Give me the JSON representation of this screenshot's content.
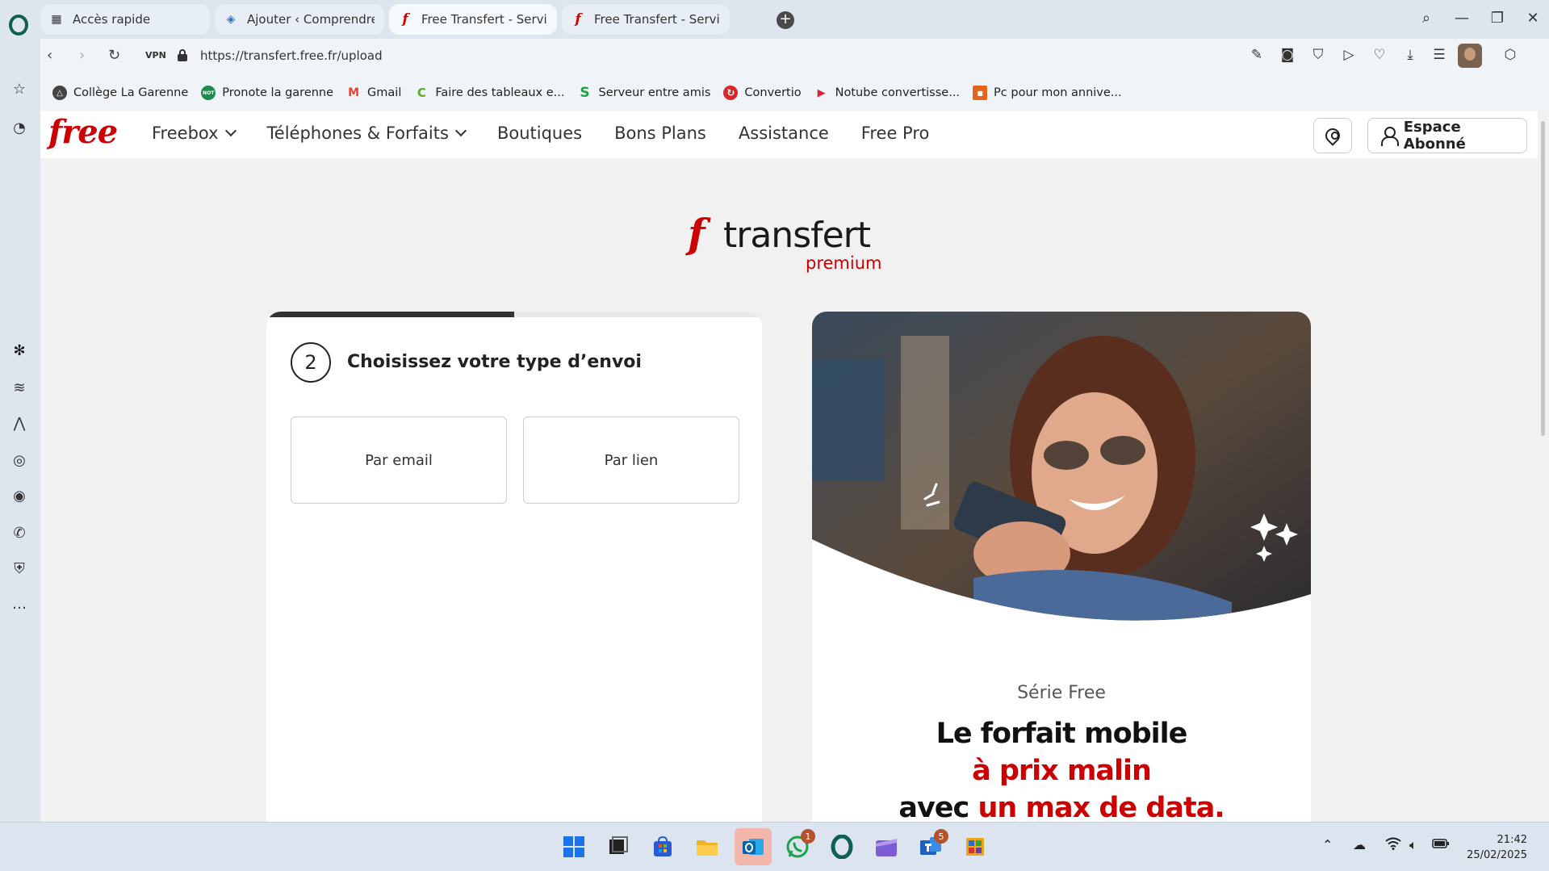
{
  "browser": {
    "tabs": [
      {
        "label": "Accès rapide",
        "icon": "grid-icon",
        "active": false
      },
      {
        "label": "Ajouter ‹ Comprendre l'i",
        "icon": "wordpress-icon",
        "active": false
      },
      {
        "label": "Free Transfert - Service d",
        "icon": "free-favicon",
        "active": true
      },
      {
        "label": "Free Transfert - Service d",
        "icon": "free-favicon",
        "active": false
      }
    ],
    "vpn_label": "VPN",
    "url": "https://transfert.free.fr/upload",
    "bookmarks": [
      {
        "label": "Collège La Garenne",
        "color": "#444444",
        "glyph": "△"
      },
      {
        "label": "Pronote la garenne",
        "color": "#1e8a4f",
        "glyph": "NOT"
      },
      {
        "label": "Gmail",
        "color": "#ea4335",
        "glyph": "M"
      },
      {
        "label": "Faire des tableaux e...",
        "color": "#5aaa2a",
        "glyph": "C"
      },
      {
        "label": "Serveur entre amis",
        "color": "#1ca24a",
        "glyph": "S"
      },
      {
        "label": "Convertio",
        "color": "#d8262b",
        "glyph": "↻"
      },
      {
        "label": "Notube convertisse...",
        "color": "#d6243c",
        "glyph": "▶"
      },
      {
        "label": "Pc pour mon annive...",
        "color": "#e8631a",
        "glyph": "■"
      }
    ]
  },
  "site": {
    "logo": "free",
    "nav": [
      {
        "label": "Freebox",
        "has_dropdown": true
      },
      {
        "label": "Téléphones & Forfaits",
        "has_dropdown": true
      },
      {
        "label": "Boutiques",
        "has_dropdown": false
      },
      {
        "label": "Bons Plans",
        "has_dropdown": false
      },
      {
        "label": "Assistance",
        "has_dropdown": false
      },
      {
        "label": "Free Pro",
        "has_dropdown": false
      }
    ],
    "account_label": "Espace Abonné",
    "brand_mark": "f",
    "brand_word": "transfert",
    "brand_tier": "premium",
    "accent_color": "#cc0000"
  },
  "upload_card": {
    "progress_percent": 50,
    "step_number": "2",
    "step_title": "Choisissez votre type d’envoi",
    "options": [
      "Par email",
      "Par lien"
    ]
  },
  "promo": {
    "subtitle": "Série Free",
    "title_line1": "Le forfait mobile",
    "title_line2": "à prix malin",
    "title_line3_prefix": "avec ",
    "title_line3_highlight": "un max de data."
  },
  "taskbar": {
    "apps": [
      {
        "name": "windows-start-icon",
        "badge": ""
      },
      {
        "name": "task-view-icon",
        "badge": ""
      },
      {
        "name": "microsoft-store-icon",
        "badge": ""
      },
      {
        "name": "file-explorer-icon",
        "badge": ""
      },
      {
        "name": "outlook-icon",
        "badge": ""
      },
      {
        "name": "whatsapp-icon",
        "badge": "1"
      },
      {
        "name": "opera-icon",
        "badge": ""
      },
      {
        "name": "clipchamp-icon",
        "badge": ""
      },
      {
        "name": "teams-icon",
        "badge": "5"
      },
      {
        "name": "app-icon",
        "badge": ""
      }
    ],
    "time": "21:42",
    "date": "25/02/2025"
  }
}
